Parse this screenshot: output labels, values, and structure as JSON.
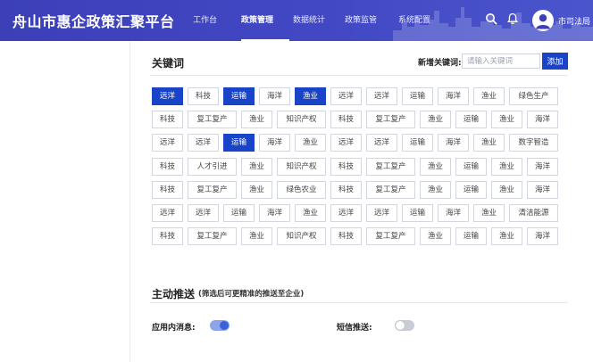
{
  "app": {
    "title": "舟山市惠企政策汇聚平台"
  },
  "nav": [
    {
      "label": "工作台",
      "active": false
    },
    {
      "label": "政策管理",
      "active": true
    },
    {
      "label": "数据统计",
      "active": false
    },
    {
      "label": "政策监管",
      "active": false
    },
    {
      "label": "系统配置",
      "active": false
    }
  ],
  "user": {
    "name": "市司法局"
  },
  "icons": {
    "search": "search-icon",
    "bell": "bell-icon",
    "avatar": "user-avatar-icon"
  },
  "colors": {
    "header": "#3c3fb8",
    "accent": "#1a44c8",
    "toggle_on": "#3b62d8",
    "toggle_off": "#c9ccd4"
  },
  "keywords": {
    "title": "关键词",
    "add_label": "新增关键词:",
    "input_value": "",
    "input_placeholder": "请输入关键词",
    "add_button": "添加",
    "rows": [
      [
        {
          "label": "远洋",
          "selected": true
        },
        {
          "label": "科技",
          "selected": false
        },
        {
          "label": "运输",
          "selected": true
        },
        {
          "label": "海洋",
          "selected": false
        },
        {
          "label": "渔业",
          "selected": true
        },
        {
          "label": "远洋",
          "selected": false
        },
        {
          "label": "远洋",
          "selected": false
        },
        {
          "label": "运输",
          "selected": false
        },
        {
          "label": "海洋",
          "selected": false
        },
        {
          "label": "渔业",
          "selected": false
        },
        {
          "label": "绿色生产",
          "selected": false
        }
      ],
      [
        {
          "label": "科技",
          "selected": false
        },
        {
          "label": "复工复产",
          "selected": false
        },
        {
          "label": "渔业",
          "selected": false
        },
        {
          "label": "知识产权",
          "selected": false
        },
        {
          "label": "科技",
          "selected": false
        },
        {
          "label": "复工复产",
          "selected": false
        },
        {
          "label": "渔业",
          "selected": false
        },
        {
          "label": "运输",
          "selected": false
        },
        {
          "label": "渔业",
          "selected": false
        },
        {
          "label": "海洋",
          "selected": false
        }
      ],
      [
        {
          "label": "远洋",
          "selected": false
        },
        {
          "label": "远洋",
          "selected": false
        },
        {
          "label": "运输",
          "selected": true
        },
        {
          "label": "海洋",
          "selected": false
        },
        {
          "label": "渔业",
          "selected": false
        },
        {
          "label": "远洋",
          "selected": false
        },
        {
          "label": "远洋",
          "selected": false
        },
        {
          "label": "运输",
          "selected": false
        },
        {
          "label": "海洋",
          "selected": false
        },
        {
          "label": "渔业",
          "selected": false
        },
        {
          "label": "数字智造",
          "selected": false
        }
      ],
      [
        {
          "label": "科技",
          "selected": false
        },
        {
          "label": "人才引进",
          "selected": false
        },
        {
          "label": "渔业",
          "selected": false
        },
        {
          "label": "知识产权",
          "selected": false
        },
        {
          "label": "科技",
          "selected": false
        },
        {
          "label": "复工复产",
          "selected": false
        },
        {
          "label": "渔业",
          "selected": false
        },
        {
          "label": "运输",
          "selected": false
        },
        {
          "label": "渔业",
          "selected": false
        },
        {
          "label": "海洋",
          "selected": false
        }
      ],
      [
        {
          "label": "科技",
          "selected": false
        },
        {
          "label": "复工复产",
          "selected": false
        },
        {
          "label": "渔业",
          "selected": false
        },
        {
          "label": "绿色农业",
          "selected": false
        },
        {
          "label": "科技",
          "selected": false
        },
        {
          "label": "复工复产",
          "selected": false
        },
        {
          "label": "渔业",
          "selected": false
        },
        {
          "label": "运输",
          "selected": false
        },
        {
          "label": "渔业",
          "selected": false
        },
        {
          "label": "海洋",
          "selected": false
        }
      ],
      [
        {
          "label": "远洋",
          "selected": false
        },
        {
          "label": "远洋",
          "selected": false
        },
        {
          "label": "运输",
          "selected": false
        },
        {
          "label": "海洋",
          "selected": false
        },
        {
          "label": "渔业",
          "selected": false
        },
        {
          "label": "远洋",
          "selected": false
        },
        {
          "label": "远洋",
          "selected": false
        },
        {
          "label": "运输",
          "selected": false
        },
        {
          "label": "海洋",
          "selected": false
        },
        {
          "label": "渔业",
          "selected": false
        },
        {
          "label": "清洁能源",
          "selected": false
        }
      ],
      [
        {
          "label": "科技",
          "selected": false
        },
        {
          "label": "复工复产",
          "selected": false
        },
        {
          "label": "渔业",
          "selected": false
        },
        {
          "label": "知识产权",
          "selected": false
        },
        {
          "label": "科技",
          "selected": false
        },
        {
          "label": "复工复产",
          "selected": false
        },
        {
          "label": "渔业",
          "selected": false
        },
        {
          "label": "运输",
          "selected": false
        },
        {
          "label": "渔业",
          "selected": false
        },
        {
          "label": "海洋",
          "selected": false
        }
      ]
    ]
  },
  "push": {
    "title": "主动推送",
    "subtitle": "(筛选后可更精准的推送至企业)",
    "in_app": {
      "label": "应用内消息:",
      "on": true
    },
    "sms": {
      "label": "短信推送:",
      "on": false
    }
  }
}
